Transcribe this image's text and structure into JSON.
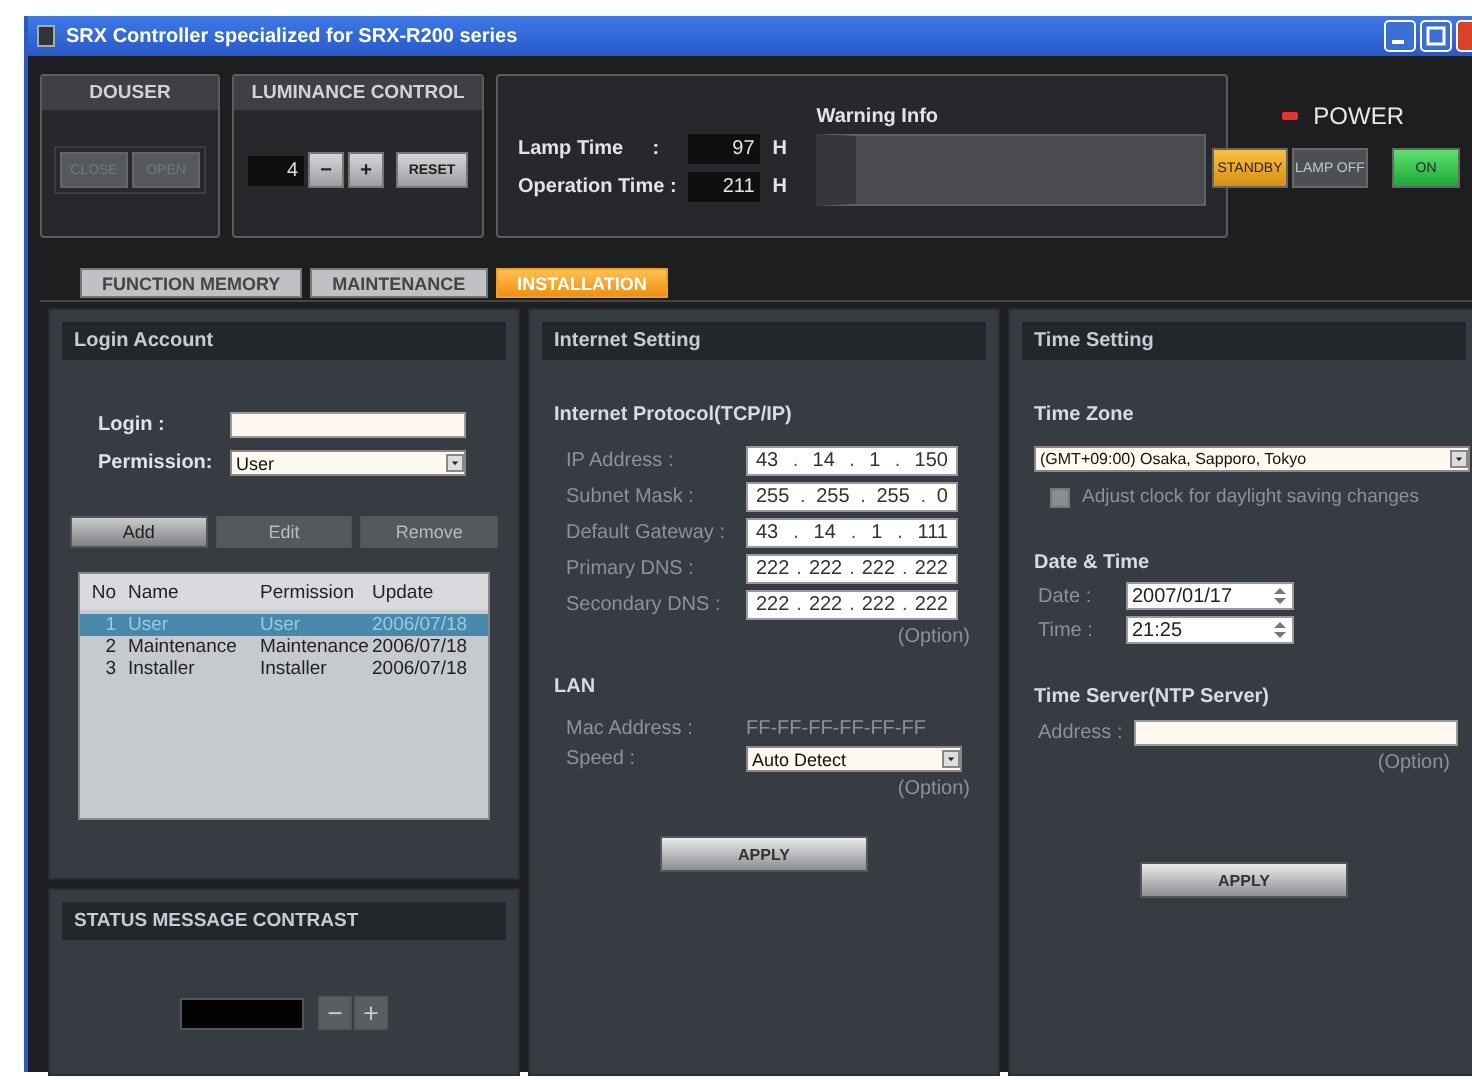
{
  "window": {
    "title": "SRX Controller specialized for SRX-R200 series"
  },
  "douser": {
    "title": "DOUSER",
    "buttons": [
      {
        "label": "CLOSE",
        "disabled": true
      },
      {
        "label": "OPEN",
        "disabled": true
      }
    ]
  },
  "luminance": {
    "title": "LUMINANCE CONTROL",
    "value": "4",
    "buttons": [
      {
        "label": "−",
        "disabled": false
      },
      {
        "label": "+",
        "disabled": false
      },
      {
        "label": "RESET",
        "disabled": false
      }
    ]
  },
  "lamp": {
    "lamp_time_label": "Lamp Time",
    "lamp_time_sep": ":",
    "lamp_time": "97",
    "lamp_unit": "H",
    "operation_label": "Operation Time :",
    "operation_time": "211",
    "operation_unit": "H",
    "warning_title": "Warning Info"
  },
  "power": {
    "title": "POWER",
    "led_on": true,
    "buttons": [
      {
        "label": "STANDBY",
        "kind": "standby",
        "disabled": false
      },
      {
        "label": "LAMP OFF",
        "kind": "lampoff",
        "disabled": true
      },
      {
        "label": "ON",
        "kind": "on",
        "disabled": false
      }
    ]
  },
  "tabs": [
    {
      "label": "FUNCTION MEMORY",
      "selected": false
    },
    {
      "label": "MAINTENANCE",
      "selected": false
    },
    {
      "label": "INSTALLATION",
      "selected": true
    }
  ],
  "login_account": {
    "title": "Login Account",
    "login_label": "Login :",
    "permission_label": "Permission:",
    "permission_value": "User",
    "buttons": [
      {
        "label": "Add",
        "disabled": false
      },
      {
        "label": "Edit",
        "disabled": true
      },
      {
        "label": "Remove",
        "disabled": true
      }
    ],
    "columns": [
      "No",
      "Name",
      "Permission",
      "Update"
    ],
    "rows": [
      {
        "cells": [
          "1",
          "User",
          "User",
          "2006/07/18"
        ],
        "selected": true
      },
      {
        "cells": [
          "2",
          "Maintenance",
          "Maintenance",
          "2006/07/18"
        ],
        "selected": false
      },
      {
        "cells": [
          "3",
          "Installer",
          "Installer",
          "2006/07/18"
        ],
        "selected": false
      }
    ]
  },
  "status_contrast": {
    "title": "STATUS MESSAGE CONTRAST",
    "buttons": [
      {
        "label": "−",
        "disabled": true
      },
      {
        "label": "+",
        "disabled": true
      }
    ]
  },
  "internet": {
    "title": "Internet Setting",
    "protocol_title": "Internet Protocol(TCP/IP)",
    "fields": [
      {
        "label": "IP Address :",
        "octets": [
          "43",
          "14",
          "1",
          "150"
        ]
      },
      {
        "label": "Subnet Mask :",
        "octets": [
          "255",
          "255",
          "255",
          "0"
        ]
      },
      {
        "label": "Default Gateway :",
        "octets": [
          "43",
          "14",
          "1",
          "111"
        ]
      },
      {
        "label": "Primary DNS :",
        "octets": [
          "222",
          "222",
          "222",
          "222"
        ]
      },
      {
        "label": "Secondary DNS :",
        "octets": [
          "222",
          "222",
          "222",
          "222"
        ]
      }
    ],
    "dot": ".",
    "option_1": "(Option)",
    "lan_title": "LAN",
    "mac_label": "Mac Address :",
    "mac_value": "FF-FF-FF-FF-FF-FF",
    "speed_label": "Speed :",
    "speed_value": "Auto Detect",
    "option_2": "(Option)",
    "apply": "APPLY"
  },
  "time": {
    "title": "Time Setting",
    "zone_title": "Time Zone",
    "zone_value": "(GMT+09:00) Osaka, Sapporo, Tokyo",
    "daylight_label": "Adjust clock for daylight saving changes",
    "daylight_checked": false,
    "datetime_title": "Date & Time",
    "date_label": "Date :",
    "date_value": "2007/01/17",
    "time_label": "Time :",
    "time_value": "21:25",
    "ntp_title": "Time Server(NTP Server)",
    "address_label": "Address :",
    "option": "(Option)",
    "apply": "APPLY"
  }
}
